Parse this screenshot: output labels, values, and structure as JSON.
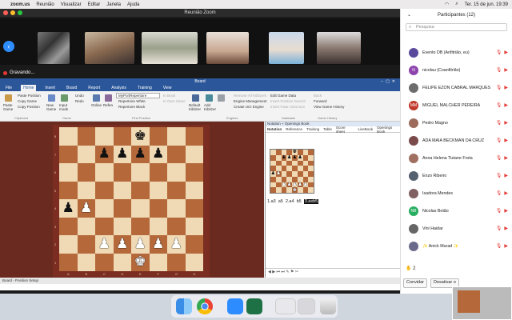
{
  "menubar": {
    "app": "zoom.us",
    "items": [
      "Reunião",
      "Visualizar",
      "Editar",
      "Janela",
      "Ajuda"
    ],
    "datetime": "Ter. 15 de jun.  19:39"
  },
  "zoom": {
    "window_title": "Reunião Zoom",
    "recording": "Gravando..."
  },
  "chessbase": {
    "title": "Board",
    "tabs": [
      "File",
      "Home",
      "Insert",
      "Board",
      "Report",
      "Analysis",
      "Training",
      "View"
    ],
    "active_tab": "Home",
    "ribbon": {
      "paste_game": "Paste Game",
      "paste_position": "Paste Position",
      "copy_game": "Copy Game",
      "copy_position": "Copy Position",
      "clipboard": "Clipboard",
      "new_game": "New Game",
      "input_mode": "Input mode",
      "undo": "Undo",
      "redo": "Redo",
      "game": "Game",
      "online": "Online",
      "reference": "Reference",
      "myportrepertoire": "MyPortRepertoire",
      "repertoire_white": "Repertoire White",
      "repertoire_black": "Repertoire Black",
      "find_position": "Find Position",
      "in_book": "In Book",
      "in_own_game": "In Own Game",
      "default_kibitzer": "Default Kibitzer",
      "add_kibitzer": "Add Kibitzer",
      "remove_all_kibitzers": "Remove All Kibitzers",
      "engine_management": "Engine Management",
      "create_uci_engine": "Create UCI Engine",
      "engines": "Engines",
      "edit_game_data": "Edit Game Data",
      "insert_position_search": "Insert Position Search",
      "insert_pawn_structure": "Insert Pawn Structure",
      "insert_new_game": "Insert New Game",
      "database": "Database",
      "back": "Back",
      "forward": "Forward",
      "view_game_history": "View Game History",
      "game_history": "Game History"
    },
    "notation_header": "Notation + Openings Book",
    "notation_tabs": [
      "Notation",
      "Reference",
      "Training",
      "Table",
      "Score sheet",
      "LiveBook",
      "Openings Book"
    ],
    "moves": [
      "1.a3",
      "a5",
      "2.a4",
      "b5",
      "3.axb5"
    ],
    "current_move": "3.axb5",
    "status": "Board - Position Setup",
    "ranks": [
      "8",
      "7",
      "6",
      "5",
      "4",
      "3",
      "2",
      "1"
    ],
    "files": [
      "A",
      "B",
      "C",
      "D",
      "E",
      "F",
      "G",
      "H"
    ]
  },
  "participants": {
    "title": "Participantes (12)",
    "search_placeholder": "Pesquisa",
    "list": [
      {
        "name": "Evento DB (Anfitrião, eu)",
        "initials": "",
        "color": "#5b4a9c"
      },
      {
        "name": "nicolau (Coanfitrião)",
        "initials": "N",
        "color": "#8e44ad"
      },
      {
        "name": "FELIPE EZON CABRAL MARQUES",
        "initials": "",
        "color": "#6d6d6d"
      },
      {
        "name": "MIGUEL MALCHER PEREIRA",
        "initials": "MM",
        "color": "#c0392b"
      },
      {
        "name": "Pedro Magno",
        "initials": "",
        "color": "#9c6b5b"
      },
      {
        "name": "ADA MAIA BECKMAN DA CRUZ",
        "initials": "",
        "color": "#7b4a4a"
      },
      {
        "name": "Anna Helena Tiziane Frota",
        "initials": "",
        "color": "#a07060"
      },
      {
        "name": "Enzo Ribeiro",
        "initials": "",
        "color": "#556070"
      },
      {
        "name": "Isadora Mendes",
        "initials": "",
        "color": "#806060"
      },
      {
        "name": "Nicolas Botão",
        "initials": "NB",
        "color": "#27ae60"
      },
      {
        "name": "Vini Haidar",
        "initials": "",
        "color": "#666666"
      },
      {
        "name": "✨ Anick Murad ✨",
        "initials": "",
        "color": "#6a6a8a"
      }
    ],
    "hands": "2",
    "invite_button": "Convidar",
    "mute_button": "Desativar o"
  },
  "board": {
    "rows": [
      [
        "",
        "",
        "",
        "",
        "♚",
        "",
        "",
        ""
      ],
      [
        "",
        "",
        "♟",
        "♟",
        "♟",
        "♟",
        "",
        ""
      ],
      [
        "",
        "",
        "",
        "",
        "",
        "",
        "",
        ""
      ],
      [
        "",
        "",
        "",
        "",
        "",
        "",
        "",
        ""
      ],
      [
        "♟",
        "♙",
        "",
        "",
        "",
        "",
        "",
        ""
      ],
      [
        "",
        "",
        "",
        "",
        "",
        "",
        "",
        ""
      ],
      [
        "",
        "",
        "♙",
        "♙",
        "♙",
        "♙",
        "♙",
        ""
      ],
      [
        "",
        "",
        "",
        "",
        "♔",
        "",
        "",
        ""
      ]
    ]
  }
}
